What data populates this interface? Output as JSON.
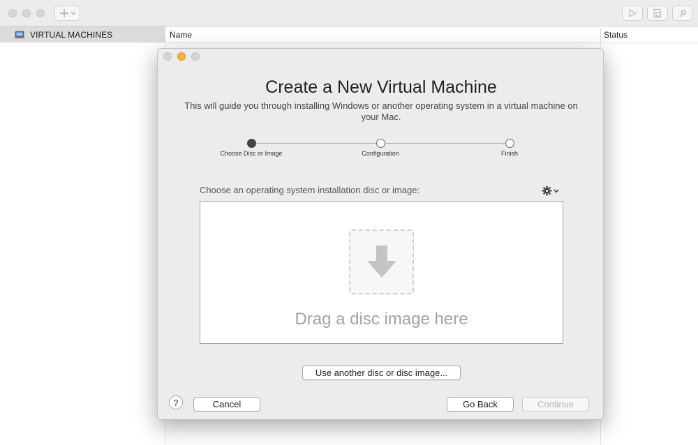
{
  "toolbar": {
    "add_icon": "plus-icon",
    "add_dropdown_icon": "chevron-down-icon",
    "run_icon": "play-icon",
    "snapshot_icon": "snapshot-icon",
    "settings_icon": "wrench-icon"
  },
  "sidebar": {
    "header_icon": "laptop-icon",
    "header_label": "VIRTUAL MACHINES"
  },
  "table": {
    "columns": [
      "Name",
      "Status"
    ]
  },
  "dialog": {
    "title": "Create a New Virtual Machine",
    "subtitle": "This will guide you through installing Windows or another operating system in a virtual machine on your Mac.",
    "steps": [
      {
        "label": "Choose Disc or Image",
        "active": true
      },
      {
        "label": "Configuration",
        "active": false
      },
      {
        "label": "Finish",
        "active": false
      }
    ],
    "choose_label": "Choose an operating system installation disc or image:",
    "gear_icon": "gear-icon",
    "drop_icon": "download-arrow-icon",
    "drop_text": "Drag a disc image here",
    "use_another_button": "Use another disc or disc image...",
    "help_button": "?",
    "cancel_button": "Cancel",
    "go_back_button": "Go Back",
    "continue_button": "Continue",
    "continue_enabled": false
  },
  "colors": {
    "minimize_yellow": "#f5b33f",
    "window_bg": "#ececec"
  }
}
